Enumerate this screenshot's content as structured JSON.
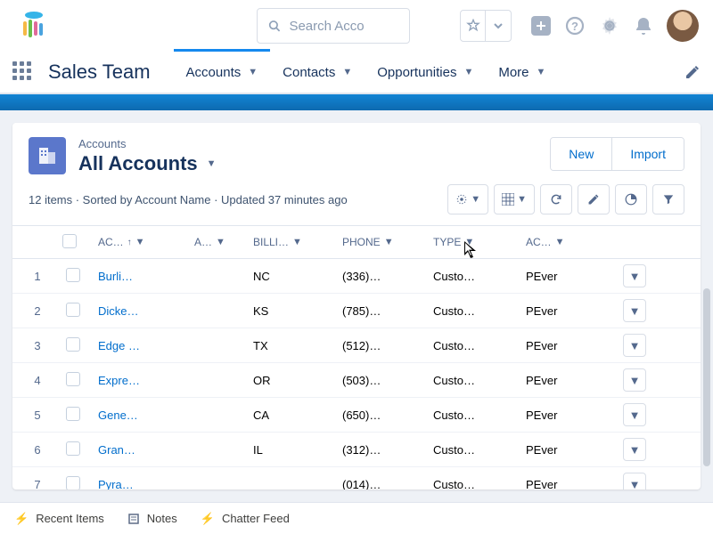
{
  "search": {
    "placeholder": "Search Acco"
  },
  "app_name": "Sales Team",
  "nav": {
    "accounts": "Accounts",
    "contacts": "Contacts",
    "opportunities": "Opportunities",
    "more": "More"
  },
  "object": {
    "subtitle": "Accounts",
    "title": "All Accounts"
  },
  "header_actions": {
    "new": "New",
    "import": "Import"
  },
  "meta": "12 items · Sorted by Account Name · Updated 37 minutes ago",
  "columns": {
    "name": "AC…",
    "a2": "A…",
    "state": "BILLI…",
    "phone": "PHONE",
    "type": "TYPE",
    "owner": "AC…"
  },
  "rows": [
    {
      "n": "1",
      "name": "Burli…",
      "state": "NC",
      "phone": "(336)…",
      "type": "Custo…",
      "owner": "PEver"
    },
    {
      "n": "2",
      "name": "Dicke…",
      "state": "KS",
      "phone": "(785)…",
      "type": "Custo…",
      "owner": "PEver"
    },
    {
      "n": "3",
      "name": "Edge …",
      "state": "TX",
      "phone": "(512)…",
      "type": "Custo…",
      "owner": "PEver"
    },
    {
      "n": "4",
      "name": "Expre…",
      "state": "OR",
      "phone": "(503)…",
      "type": "Custo…",
      "owner": "PEver"
    },
    {
      "n": "5",
      "name": "Gene…",
      "state": "CA",
      "phone": "(650)…",
      "type": "Custo…",
      "owner": "PEver"
    },
    {
      "n": "6",
      "name": "Gran…",
      "state": "IL",
      "phone": "(312)…",
      "type": "Custo…",
      "owner": "PEver"
    },
    {
      "n": "7",
      "name": "Pyra…",
      "state": "",
      "phone": "(014)…",
      "type": "Custo…",
      "owner": "PEver"
    }
  ],
  "footer": {
    "recent": "Recent Items",
    "notes": "Notes",
    "chatter": "Chatter Feed"
  }
}
